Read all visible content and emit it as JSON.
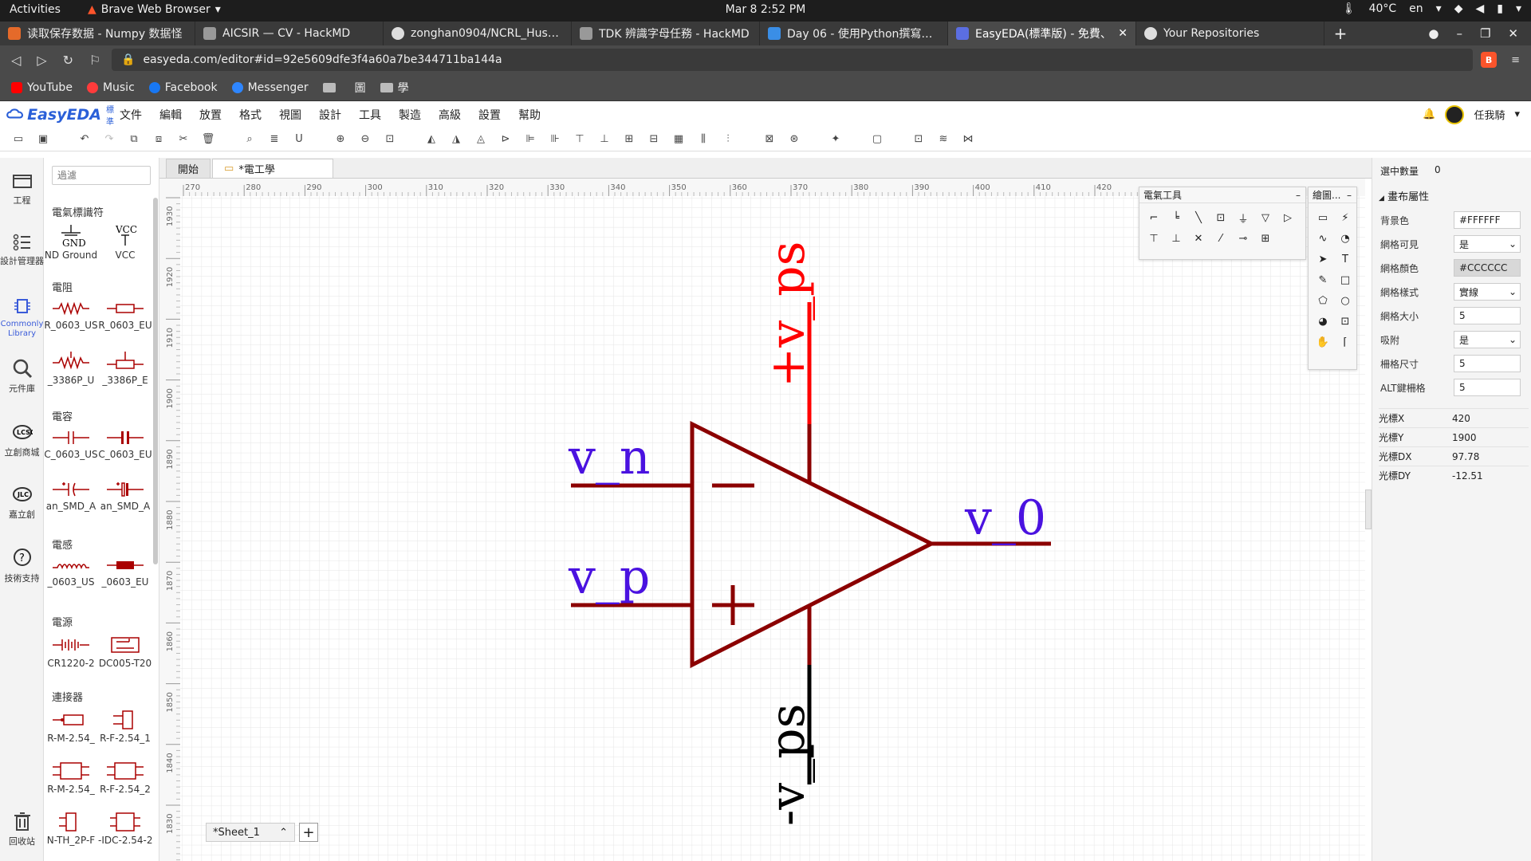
{
  "system": {
    "activities": "Activities",
    "app_name": "Brave Web Browser",
    "clock": "Mar 8  2:52 PM",
    "temperature": "40°C",
    "lang": "en"
  },
  "browser": {
    "tabs": [
      {
        "label": "读取保存数据 - Numpy 数据怪",
        "color": "#e56a2a"
      },
      {
        "label": "AICSIR — CV - HackMD",
        "color": "#999999"
      },
      {
        "label": "zonghan0904/NCRL_Huskey_",
        "color": "#dddddd"
      },
      {
        "label": "TDK 辨識字母任務 - HackMD",
        "color": "#999999"
      },
      {
        "label": "Day 06 - 使用Python撰寫ROS",
        "color": "#3a8ee6"
      },
      {
        "label": "EasyEDA(標準版) - 免費、",
        "color": "#5b6ee1"
      },
      {
        "label": "Your Repositories",
        "color": "#dddddd"
      }
    ],
    "url": "easyeda.com/editor#id=92e5609dfe3f4a60a7be344711ba144a",
    "bookmarks": [
      {
        "label": "YouTube",
        "color": "#ff0000"
      },
      {
        "label": "Music",
        "color": "#ff3b3b"
      },
      {
        "label": "Facebook",
        "color": "#1877f2"
      },
      {
        "label": "Messenger",
        "color": "#2e86ff"
      }
    ],
    "folders": [
      "",
      "圖",
      "學"
    ]
  },
  "app": {
    "logo": "EasyEDA",
    "logo_badge": "標準",
    "menu": [
      "文件",
      "編輯",
      "放置",
      "格式",
      "視圖",
      "設計",
      "工具",
      "製造",
      "高級",
      "設置",
      "幫助"
    ],
    "user": "任我騎"
  },
  "rail": [
    {
      "label": "工程",
      "icon": "folder-icon"
    },
    {
      "label": "設計管理器",
      "icon": "list-icon"
    },
    {
      "label": "Commonly Library",
      "icon": "chip-icon"
    },
    {
      "label": "元件庫",
      "icon": "search-icon"
    },
    {
      "label": "立創商城",
      "icon": "lcsc-icon"
    },
    {
      "label": "嘉立創",
      "icon": "jlc-icon"
    },
    {
      "label": "技術支持",
      "icon": "help-icon"
    },
    {
      "label": "回收站",
      "icon": "trash-icon"
    }
  ],
  "library": {
    "filter_placeholder": "過濾",
    "categories": [
      "電氣標識符",
      "電阻",
      "電容",
      "電感",
      "電源",
      "連接器"
    ],
    "components": [
      "ND Ground",
      "VCC",
      "R_0603_US",
      "R_0603_EU",
      "_3386P_U",
      "_3386P_E",
      "C_0603_US",
      "C_0603_EU",
      "an_SMD_A",
      "an_SMD_A",
      "_0603_US",
      "_0603_EU",
      "CR1220-2",
      "DC005-T20",
      "R-M-2.54_",
      "R-F-2.54_1",
      "R-M-2.54_",
      "R-F-2.54_2",
      "N-TH_2P-F",
      "-IDC-2.54-2"
    ],
    "gnd_text": "GND",
    "vcc_text": "VCC"
  },
  "doctabs": {
    "start": "開始",
    "active": "*電工學"
  },
  "ruler": {
    "x_ticks": [
      "270",
      "280",
      "290",
      "300",
      "310",
      "320",
      "330",
      "340",
      "350",
      "360",
      "370",
      "380",
      "390",
      "400",
      "410",
      "420"
    ],
    "y_ticks": [
      "1930",
      "1920",
      "1910",
      "1900",
      "1890",
      "1880",
      "1870",
      "1860",
      "1850",
      "1840",
      "1830"
    ]
  },
  "schematic": {
    "label_vn": "v_n",
    "label_vp": "v_p",
    "label_v0": "v_0",
    "label_vps_pos": "+v_ps",
    "label_vps_neg": "-v_ps",
    "colors": {
      "body": "#8b0000",
      "label_blue": "#4a12e0",
      "wire_red": "#ff0000",
      "wire_black": "#000000"
    }
  },
  "panels": {
    "electrical": "電氣工具",
    "drawing": "繪圖..."
  },
  "sheet": {
    "tab": "*Sheet_1",
    "add": "+"
  },
  "props": {
    "selected_label": "選中數量",
    "selected_value": "0",
    "section": "畫布屬性",
    "rows": [
      {
        "label": "背景色",
        "value": "#FFFFFF"
      },
      {
        "label": "網格可見",
        "value": "是"
      },
      {
        "label": "網格顏色",
        "value": "#CCCCCC"
      },
      {
        "label": "網格樣式",
        "value": "實線"
      },
      {
        "label": "網格大小",
        "value": "5"
      },
      {
        "label": "吸附",
        "value": "是"
      },
      {
        "label": "柵格尺寸",
        "value": "5"
      },
      {
        "label": "ALT鍵柵格",
        "value": "5"
      }
    ],
    "cursor": [
      {
        "label": "光標X",
        "value": "420"
      },
      {
        "label": "光標Y",
        "value": "1900"
      },
      {
        "label": "光標DX",
        "value": "97.78"
      },
      {
        "label": "光標DY",
        "value": "-12.51"
      }
    ]
  }
}
